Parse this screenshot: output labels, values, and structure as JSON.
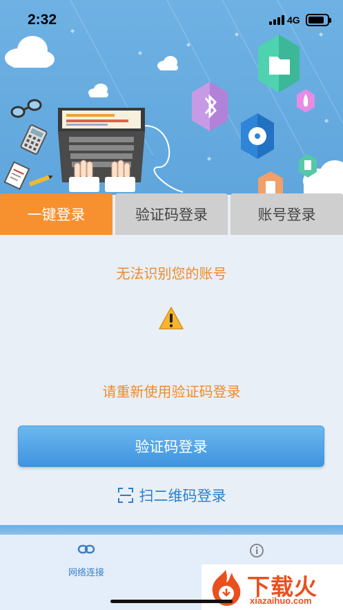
{
  "status_bar": {
    "time": "2:32",
    "network": "4G",
    "battery_level": 0.85
  },
  "tabs": [
    {
      "label": "一键登录",
      "active": true
    },
    {
      "label": "验证码登录",
      "active": false
    },
    {
      "label": "账号登录",
      "active": false
    }
  ],
  "main": {
    "error_title": "无法识别您的账号",
    "warning_icon": "warning-triangle-icon",
    "instruction": "请重新使用验证码登录",
    "primary_button": "验证码登录",
    "qr_link": "扫二维码登录"
  },
  "bottom_nav": {
    "items": [
      {
        "label": "网络连接",
        "icon": "link-icon"
      },
      {
        "label": "",
        "icon": "info-icon"
      }
    ]
  },
  "watermark": {
    "name": "下载火",
    "url": "xiazaihuo.com"
  },
  "colors": {
    "accent_orange": "#f7902f",
    "primary_blue": "#3f93df",
    "hero_blue": "#5fa6dd"
  }
}
